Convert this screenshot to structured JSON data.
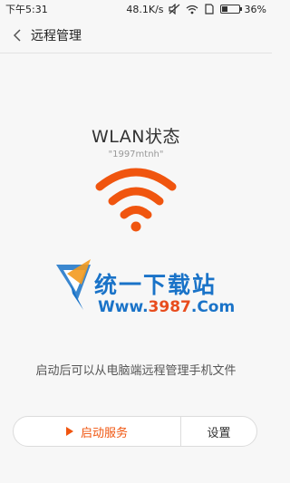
{
  "status_bar": {
    "time": "下午5:31",
    "speed": "48.1K/s",
    "battery": "36%",
    "battery_level": 0.36,
    "icons": [
      "mute-icon",
      "wifi-icon",
      "sim-icon",
      "battery-icon"
    ]
  },
  "header": {
    "title": "远程管理",
    "back_icon": "back-chevron-icon"
  },
  "main": {
    "wlan_status_title": "WLAN状态",
    "ssid": "\"1997mtnh\"",
    "wifi_icon": "wifi-icon",
    "wifi_color": "#f0550f",
    "watermark": {
      "name": "统一下载站",
      "url_prefix": "Www.",
      "url_number": "3987",
      "url_suffix": ".Com"
    },
    "description": "启动后可以从电脑端远程管理手机文件"
  },
  "actions": {
    "start_label": "启动服务",
    "settings_label": "设置",
    "accent_color": "#f0550f"
  }
}
